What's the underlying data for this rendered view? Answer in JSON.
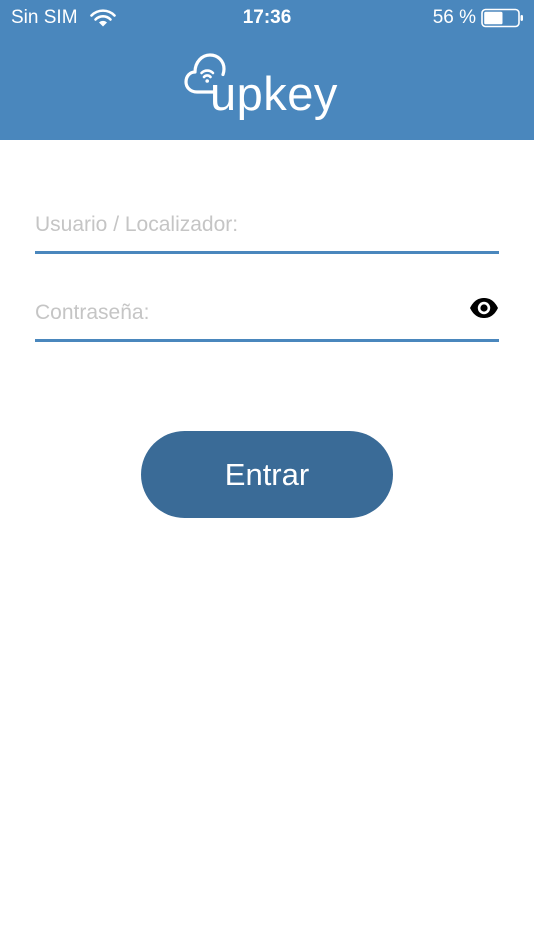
{
  "status_bar": {
    "carrier": "Sin SIM",
    "wifi_icon": "wifi-icon",
    "time": "17:36",
    "battery_percent": "56 %",
    "battery_icon": "battery-icon",
    "battery_level": 0.56
  },
  "header": {
    "logo_text": "upkey",
    "logo_icon": "cloud-wifi-icon",
    "background_color": "#4a87bd"
  },
  "form": {
    "username": {
      "placeholder": "Usuario / Localizador:",
      "value": ""
    },
    "password": {
      "placeholder": "Contraseña:",
      "value": "",
      "toggle_icon": "eye-icon"
    },
    "submit_label": "Entrar",
    "button_color": "#3a6b97",
    "underline_color": "#4a87bd"
  }
}
